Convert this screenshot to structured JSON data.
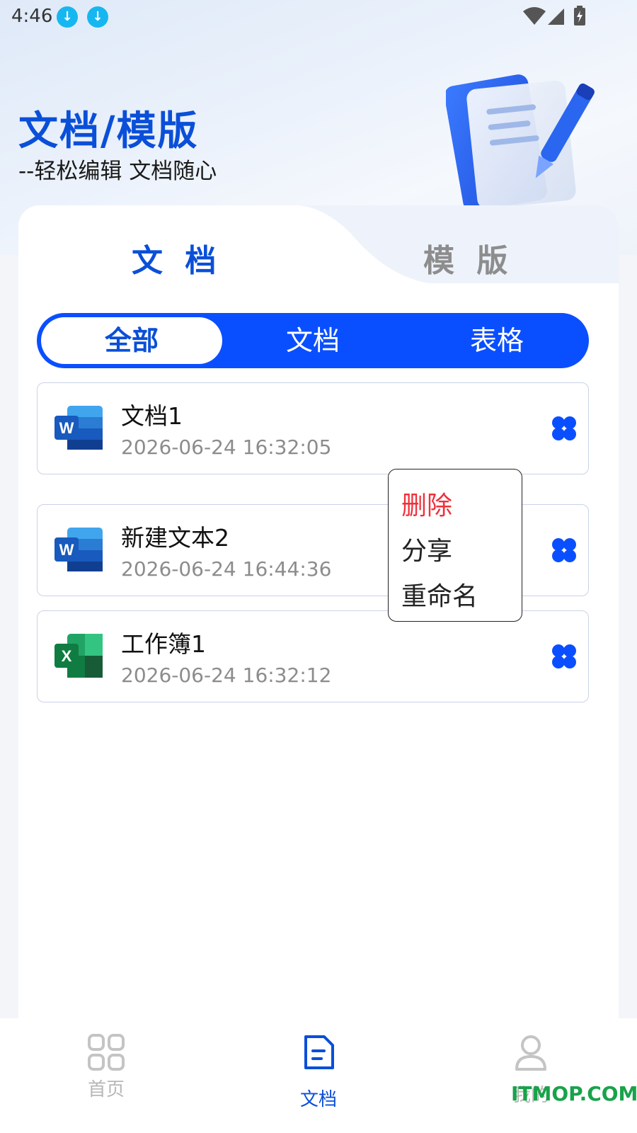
{
  "status_bar": {
    "time": "4:46"
  },
  "header": {
    "title": "文档/模版",
    "subtitle": "--轻松编辑 文档随心"
  },
  "tabs": [
    {
      "label": "文 档",
      "active": true
    },
    {
      "label": "模 版",
      "active": false
    }
  ],
  "filter": {
    "items": [
      "全部",
      "文档",
      "表格"
    ],
    "selected": "全部"
  },
  "files": [
    {
      "name": "文档1",
      "date": "2026-06-24 16:32:05",
      "type": "word"
    },
    {
      "name": "新建文本2",
      "date": "2026-06-24 16:44:36",
      "type": "word"
    },
    {
      "name": "工作簿1",
      "date": "2026-06-24 16:32:12",
      "type": "excel"
    }
  ],
  "context_menu": {
    "delete": "删除",
    "share": "分享",
    "rename": "重命名"
  },
  "bottom_nav": {
    "home": "首页",
    "docs": "文档",
    "mine": "我的"
  },
  "watermark": "ITMOP.COM",
  "colors": {
    "accent": "#0a4fff",
    "danger": "#f0303a",
    "word": "#185abd",
    "excel": "#107c41"
  }
}
